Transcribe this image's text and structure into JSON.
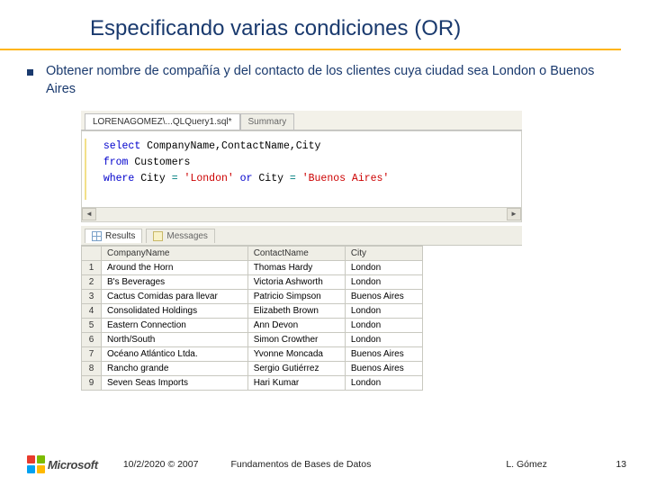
{
  "title": "Especificando varias condiciones (OR)",
  "bullet": "Obtener nombre de compañía y del contacto de los clientes cuya ciudad sea London o Buenos Aires",
  "editor_tabs": {
    "active": "LORENAGOMEZ\\...QLQuery1.sql*",
    "inactive": "Summary"
  },
  "sql": {
    "l1_kw": "select",
    "l1_rest": " CompanyName,ContactName,City",
    "l2_kw": "from",
    "l2_rest": " Customers",
    "l3a_kw": "where",
    "l3a_rest": " City ",
    "l3_eq1": "=",
    "l3_str1": " 'London' ",
    "l3_or": "or",
    "l3_rest2": " City ",
    "l3_eq2": "=",
    "l3_str2": " 'Buenos Aires'"
  },
  "result_tabs": {
    "results": "Results",
    "messages": "Messages"
  },
  "grid": {
    "cols": [
      "CompanyName",
      "ContactName",
      "City"
    ],
    "rows": [
      {
        "n": "1",
        "c": [
          "Around the Horn",
          "Thomas Hardy",
          "London"
        ]
      },
      {
        "n": "2",
        "c": [
          "B's Beverages",
          "Victoria Ashworth",
          "London"
        ]
      },
      {
        "n": "3",
        "c": [
          "Cactus Comidas para llevar",
          "Patricio Simpson",
          "Buenos Aires"
        ]
      },
      {
        "n": "4",
        "c": [
          "Consolidated Holdings",
          "Elizabeth Brown",
          "London"
        ]
      },
      {
        "n": "5",
        "c": [
          "Eastern Connection",
          "Ann Devon",
          "London"
        ]
      },
      {
        "n": "6",
        "c": [
          "North/South",
          "Simon Crowther",
          "London"
        ]
      },
      {
        "n": "7",
        "c": [
          "Océano Atlántico Ltda.",
          "Yvonne Moncada",
          "Buenos Aires"
        ]
      },
      {
        "n": "8",
        "c": [
          "Rancho grande",
          "Sergio Gutiérrez",
          "Buenos Aires"
        ]
      },
      {
        "n": "9",
        "c": [
          "Seven Seas Imports",
          "Hari Kumar",
          "London"
        ]
      }
    ]
  },
  "footer": {
    "brand": "Microsoft",
    "date": "10/2/2020 © 2007",
    "mid": "Fundamentos de Bases de Datos",
    "author": "L. Gómez",
    "page": "13"
  }
}
